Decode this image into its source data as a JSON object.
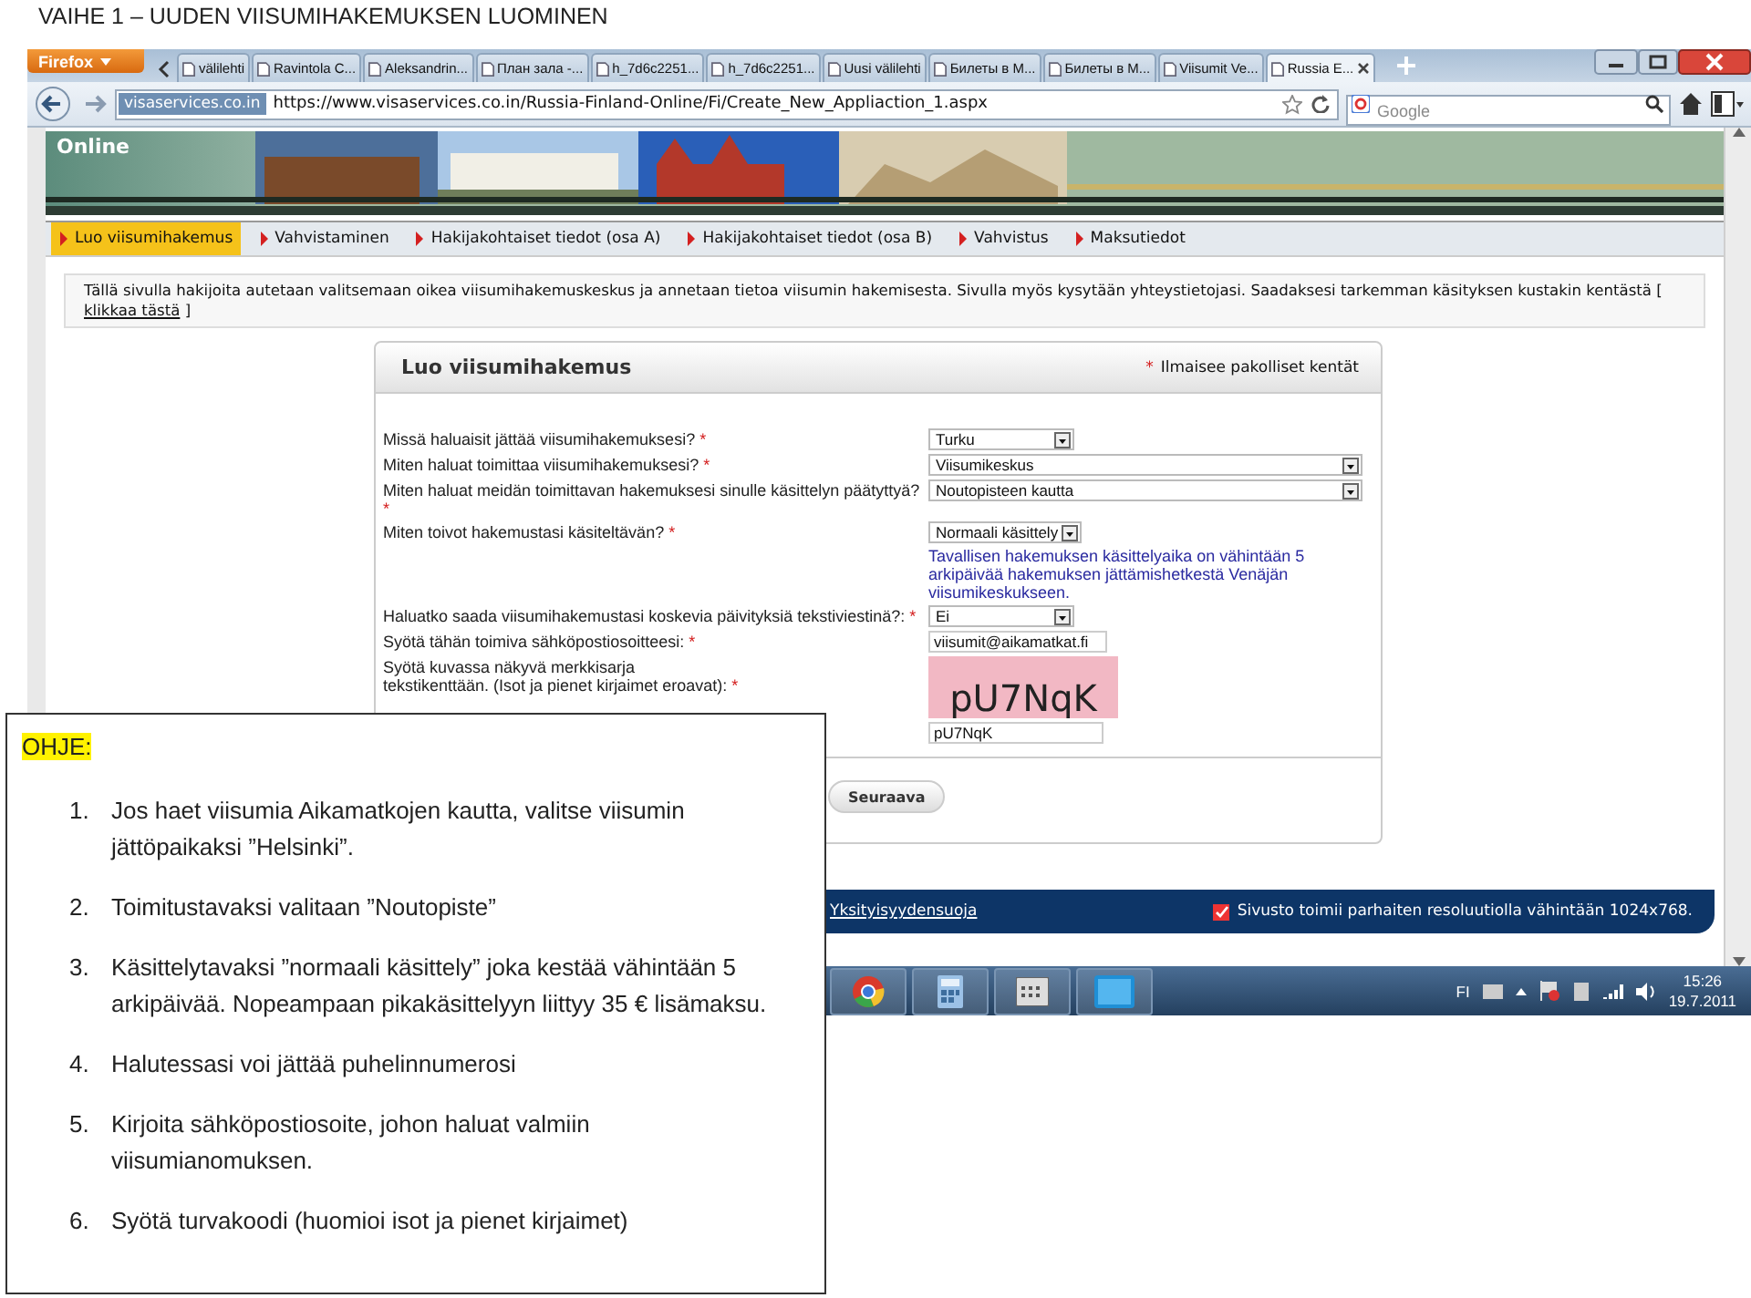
{
  "doc_title": "VAIHE 1 – UUDEN VIISUMIHAKEMUKSEN LUOMINEN",
  "browser": {
    "menu_button": "Firefox",
    "tabs": [
      {
        "label": "välilehti",
        "selected": false
      },
      {
        "label": "Ravintola C...",
        "selected": false
      },
      {
        "label": "Aleksandrin...",
        "selected": false
      },
      {
        "label": "План зала -...",
        "selected": false
      },
      {
        "label": "h_7d6c2251...",
        "selected": false
      },
      {
        "label": "h_7d6c2251...",
        "selected": false
      },
      {
        "label": "Uusi välilehti",
        "selected": false
      },
      {
        "label": "Билеты в М...",
        "selected": false
      },
      {
        "label": "Билеты в М...",
        "selected": false
      },
      {
        "label": "Viisumit Ve...",
        "selected": false
      },
      {
        "label": "Russia E...",
        "selected": true
      }
    ],
    "site_badge": "visaservices.co.in",
    "url": "https://www.visaservices.co.in/Russia-Finland-Online/Fi/Create_New_Appliaction_1.aspx",
    "search_placeholder": "Google"
  },
  "page": {
    "banner_text": "Online",
    "steps": [
      {
        "label": "Luo viisumihakemus",
        "selected": true
      },
      {
        "label": "Vahvistaminen",
        "selected": false
      },
      {
        "label": "Hakijakohtaiset tiedot (osa A)",
        "selected": false
      },
      {
        "label": "Hakijakohtaiset tiedot (osa B)",
        "selected": false
      },
      {
        "label": "Vahvistus",
        "selected": false
      },
      {
        "label": "Maksutiedot",
        "selected": false
      }
    ],
    "info": {
      "text": "Tällä sivulla hakijoita autetaan valitsemaan oikea viisumihakemuskeskus ja annetaan tietoa viisumin hakemisesta. Sivulla myös kysytään yhteystietojasi. Saadaksesi tarkemman käsityksen kustakin kentästä [",
      "link": "klikkaa tästä",
      "end": "]"
    },
    "form": {
      "title": "Luo viisumihakemus",
      "legend_mark": "*",
      "legend": "Ilmaisee pakolliset kentät",
      "rows": [
        {
          "label": "Missä haluaisit jättää viisumihakemuksesi?",
          "mark": "*",
          "kind": "select",
          "wide": false,
          "value": "Turku"
        },
        {
          "label": "Miten haluat toimittaa viisumihakemuksesi?",
          "mark": "*",
          "kind": "select",
          "wide": true,
          "value": "Viisumikeskus"
        },
        {
          "label": "Miten haluat meidän toimittavan hakemuksesi sinulle käsittelyn päätyttyä?",
          "mark": "*",
          "kind": "select",
          "wide": true,
          "value": "Noutopisteen kautta"
        },
        {
          "label": "Miten toivot hakemustasi käsiteltävän?",
          "mark": "*",
          "kind": "select",
          "wide": false,
          "value": "Normaali käsittely",
          "note": "Tavallisen hakemuksen käsittelyaika on vähintään 5 arkipäivää hakemuksen jättämishetkestä Venäjän viisumikeskukseen."
        },
        {
          "label": "Haluatko saada viisumihakemustasi koskevia päivityksiä tekstiviestinä?:",
          "mark": "*",
          "kind": "select",
          "wide": false,
          "value": "Ei"
        },
        {
          "label": "Syötä tähän toimiva sähköpostiosoitteesi:",
          "mark": "*",
          "kind": "input",
          "value": "viisumit@aikamatkat.fi"
        },
        {
          "label": "Syötä kuvassa näkyvä merkkisarja tekstikenttään. (Isot ja pienet kirjaimet eroavat):",
          "mark": "*",
          "kind": "captcha",
          "captcha": "pU7NqK",
          "value": "pU7NqK"
        }
      ],
      "button": "Seuraava"
    },
    "footer": {
      "link": "Yksityisyydensuoja",
      "note": "Sivusto toimii parhaiten resoluutiolla vähintään 1024x768."
    }
  },
  "taskbar": {
    "language": "FI",
    "time": "15:26",
    "date": "19.7.2011"
  },
  "guide": {
    "heading": "OHJE:",
    "items": [
      {
        "number": "1.",
        "text": "Jos haet viisumia Aikamatkojen kautta, valitse viisumin jättöpaikaksi ”Helsinki”."
      },
      {
        "number": "2.",
        "text": "Toimitustavaksi valitaan ”Noutopiste”"
      },
      {
        "number": "3.",
        "text": "Käsittelytavaksi ”normaali käsittely” joka kestää vähintään 5 arkipäivää. Nopeampaan pikakäsittelyyn liittyy 35 € lisämaksu."
      },
      {
        "number": "4.",
        "text": "Halutessasi voi jättää puhelinnumerosi"
      },
      {
        "number": "5.",
        "text": "Kirjoita sähköpostiosoite, johon haluat valmiin viisumianomuksen."
      },
      {
        "number": "6.",
        "text": "Syötä turvakoodi (huomioi isot ja pienet kirjaimet)"
      }
    ]
  }
}
